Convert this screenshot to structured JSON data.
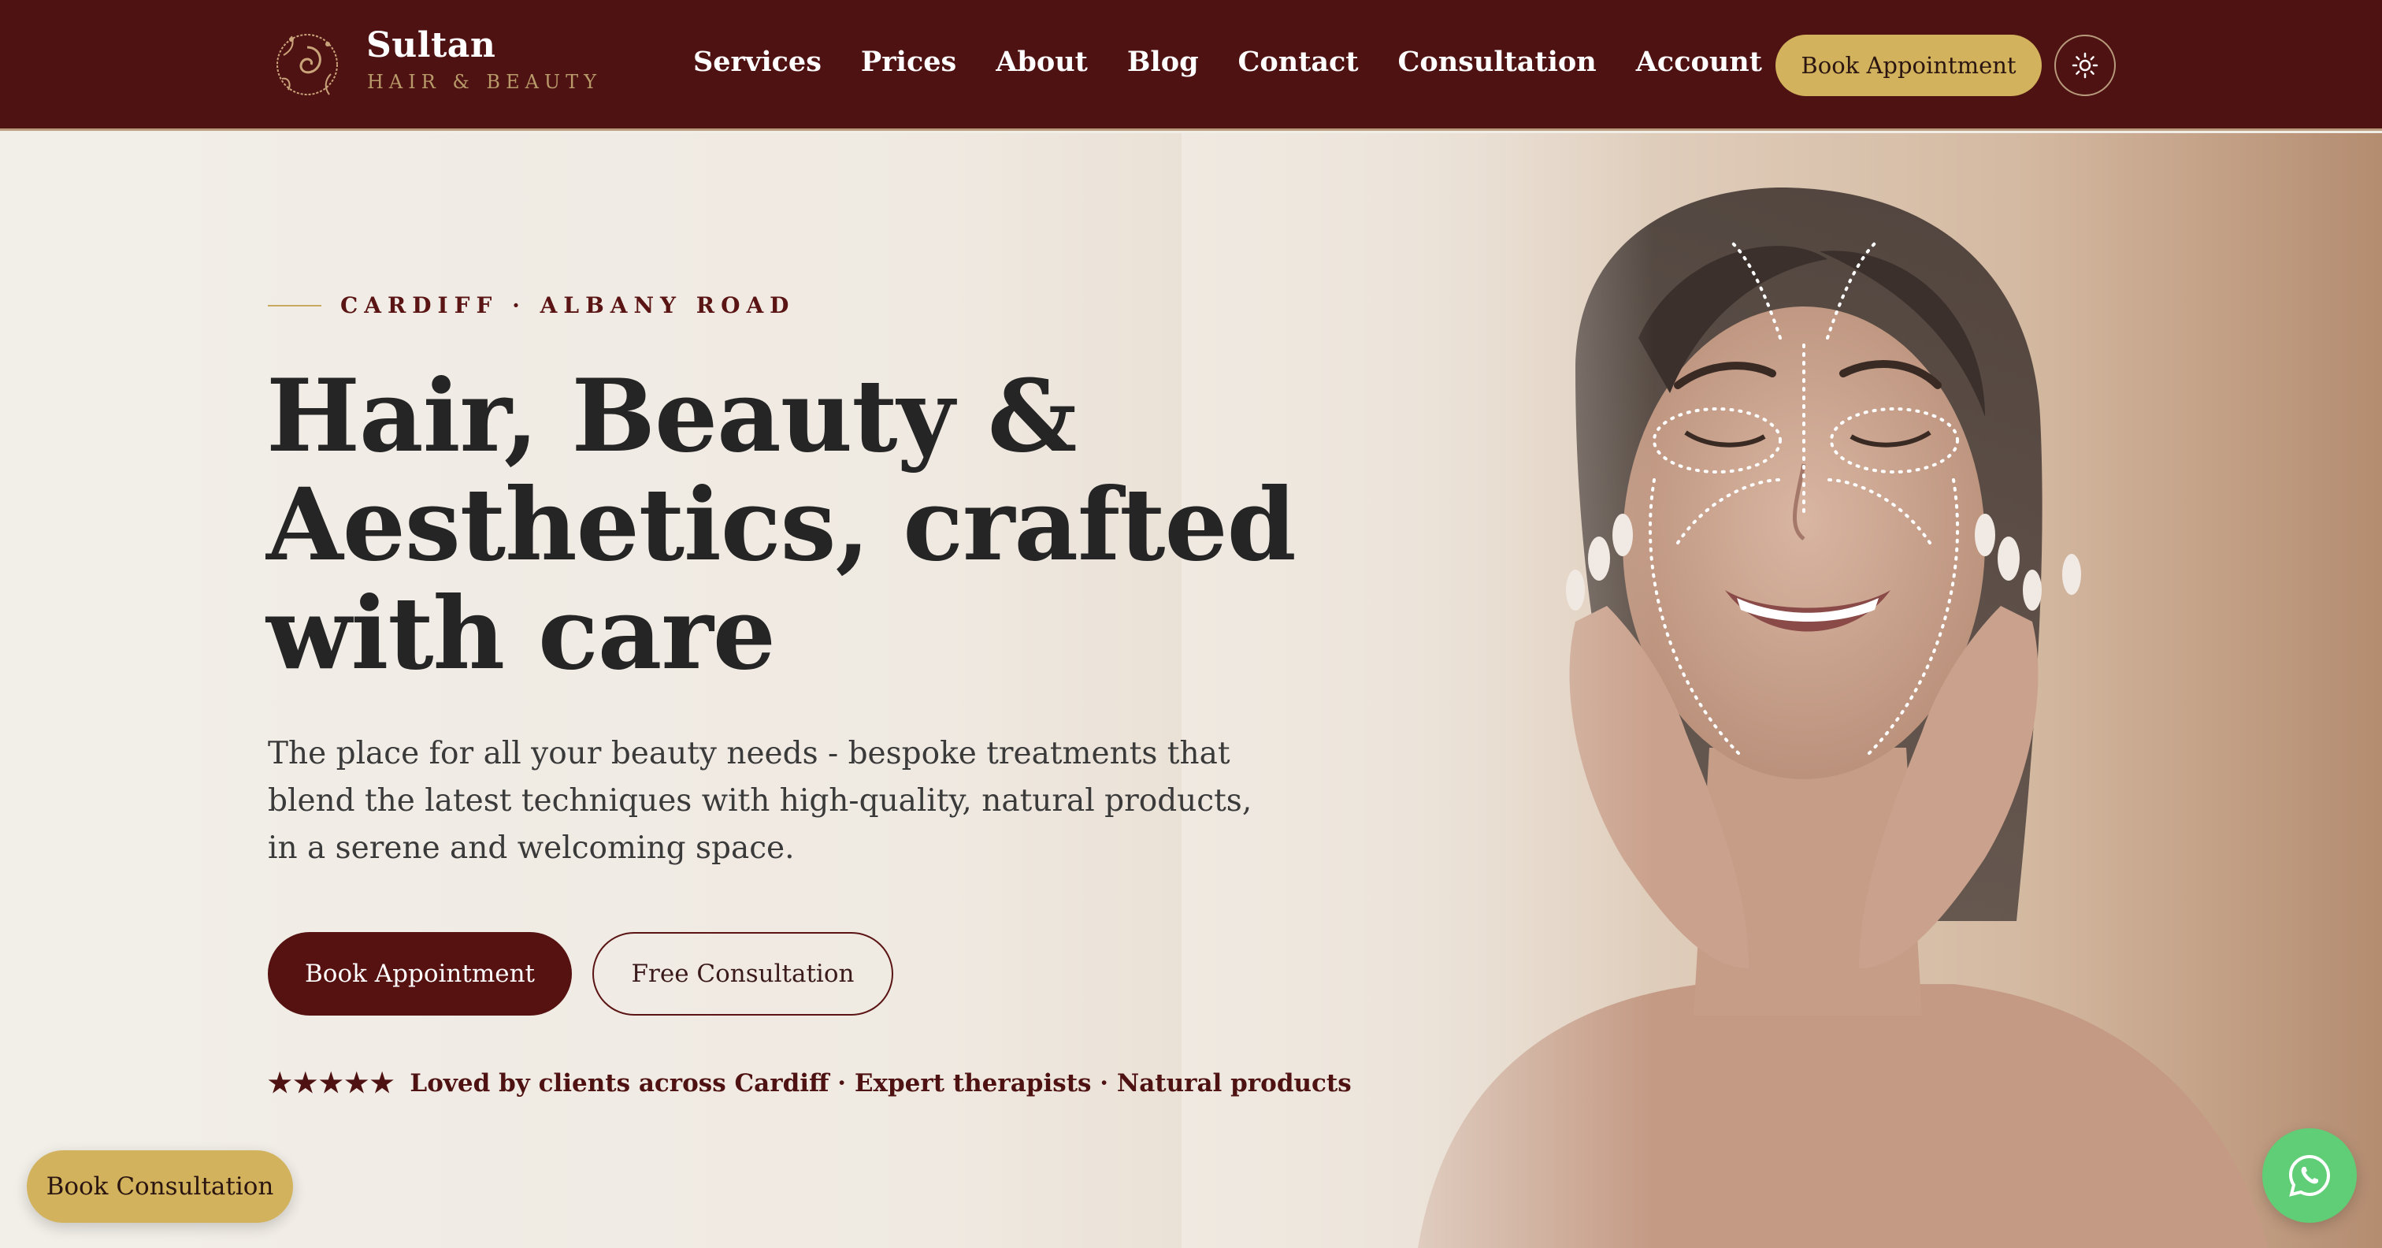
{
  "brand": {
    "name": "Sultan",
    "tagline": "HAIR & BEAUTY"
  },
  "nav": {
    "items": [
      {
        "label": "Services"
      },
      {
        "label": "Prices"
      },
      {
        "label": "About"
      },
      {
        "label": "Blog"
      },
      {
        "label": "Contact"
      },
      {
        "label": "Consultation"
      },
      {
        "label": "Account"
      }
    ],
    "book_label": "Book Appointment",
    "theme_icon": "sun-icon"
  },
  "hero": {
    "eyebrow": "CARDIFF · ALBANY ROAD",
    "title": "Hair, Beauty & Aesthetics, crafted with care",
    "subtitle": "The place for all your beauty needs - bespoke treatments that blend the latest techniques with high-quality, natural products, in a serene and welcoming space.",
    "primary_cta": "Book Appointment",
    "secondary_cta": "Free Consultation",
    "stars": "★★★★★",
    "trust_text": "Loved by clients across Cardiff · Expert therapists · Natural products"
  },
  "floating": {
    "consult_label": "Book Consultation",
    "whatsapp_icon": "whatsapp-icon"
  },
  "colors": {
    "header_bg": "#4f1212",
    "gold": "#d2b25c",
    "maroon": "#561111",
    "whatsapp": "#5fce76"
  }
}
